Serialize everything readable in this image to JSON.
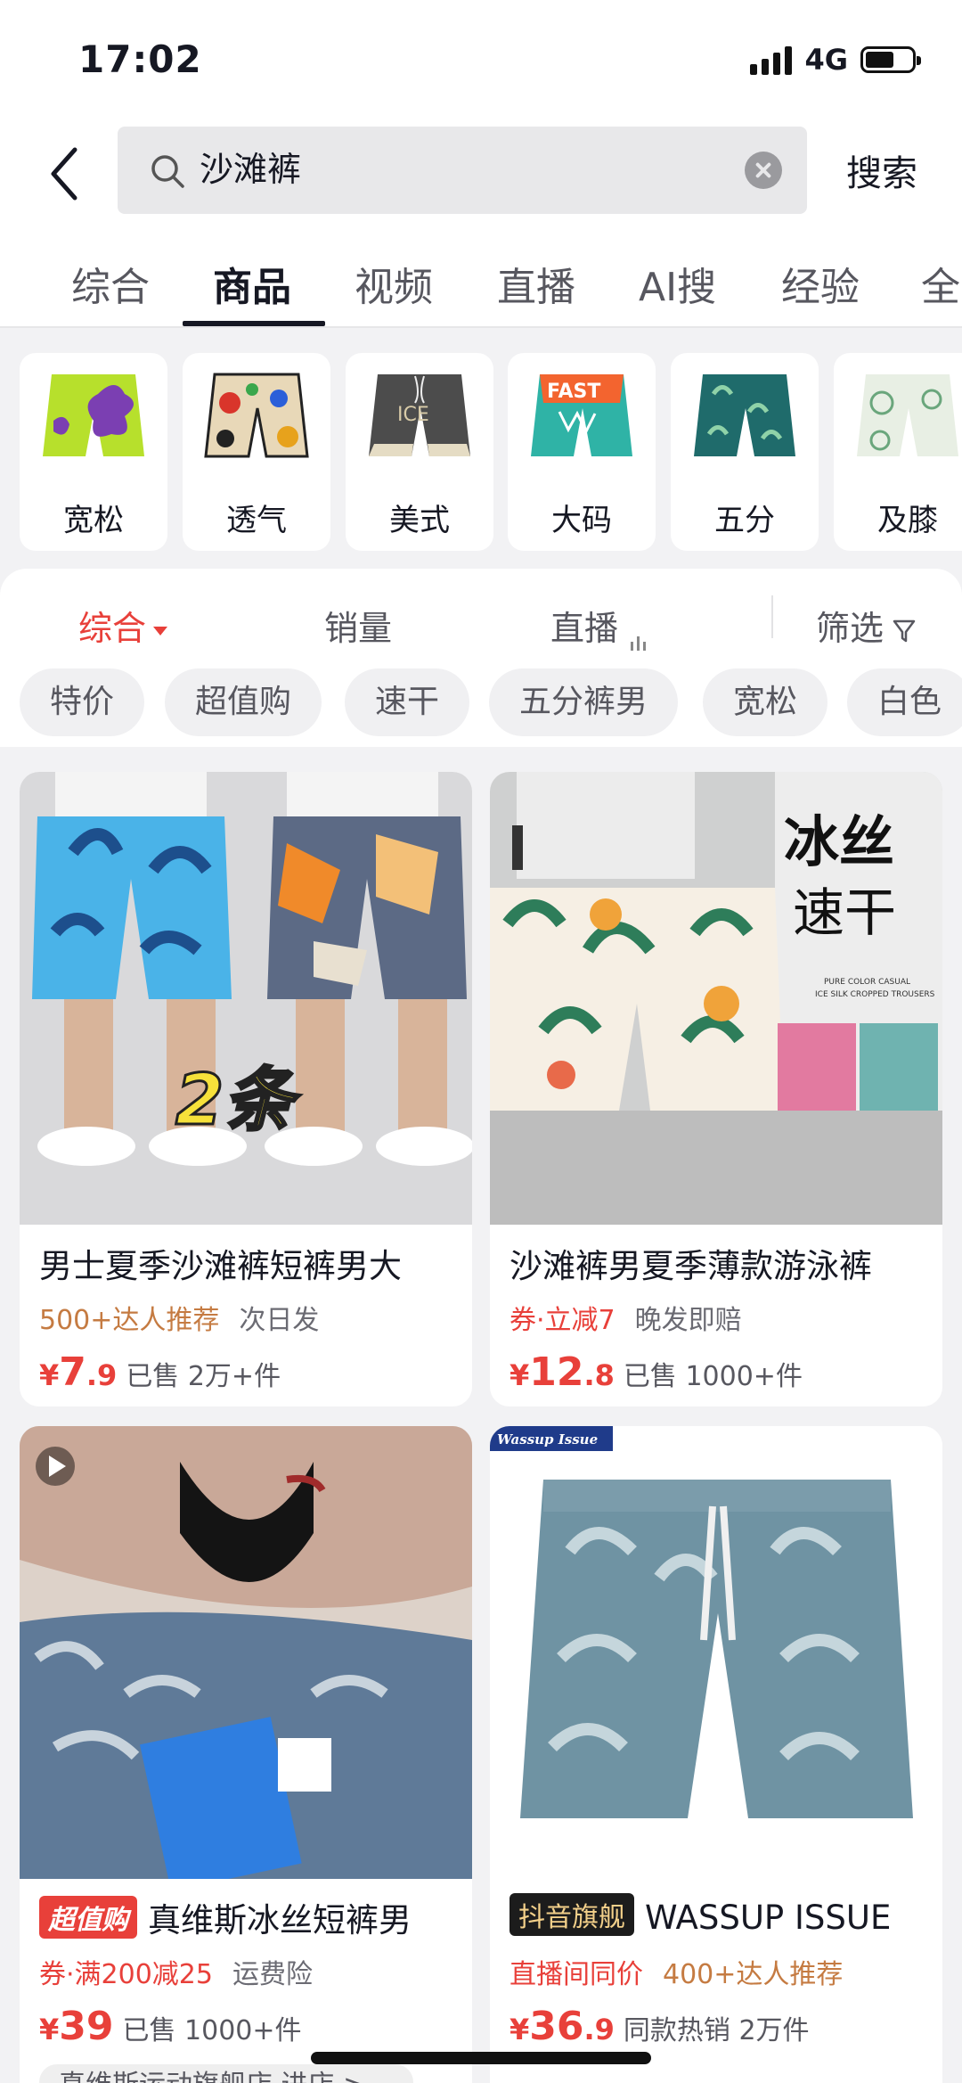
{
  "status_bar": {
    "time": "17:02",
    "network": "4G",
    "battery_level": 0.62
  },
  "search": {
    "query": "沙滩裤",
    "button_label": "搜索"
  },
  "tabs": [
    {
      "label": "综合",
      "active": false
    },
    {
      "label": "商品",
      "active": true
    },
    {
      "label": "视频",
      "active": false
    },
    {
      "label": "直播",
      "active": false
    },
    {
      "label": "AI搜",
      "active": false
    },
    {
      "label": "经验",
      "active": false
    },
    {
      "label": "全",
      "active": false
    }
  ],
  "categories": [
    {
      "label": "宽松"
    },
    {
      "label": "透气"
    },
    {
      "label": "美式"
    },
    {
      "label": "大码"
    },
    {
      "label": "五分"
    },
    {
      "label": "及膝"
    }
  ],
  "sort": {
    "options": [
      {
        "label": "综合",
        "active": true
      },
      {
        "label": "销量",
        "active": false
      },
      {
        "label": "直播",
        "active": false
      }
    ],
    "filter_label": "筛选"
  },
  "quick_filters": [
    "特价",
    "超值购",
    "速干",
    "五分裤男",
    "宽松",
    "白色"
  ],
  "products": [
    {
      "title": "男士夏季沙滩裤短裤男大",
      "image_text": "2条",
      "tags": [
        {
          "text": "500+达人推荐",
          "style": "orange"
        },
        {
          "text": "次日发",
          "style": "gray"
        }
      ],
      "price_int": "7",
      "price_dec": ".9",
      "price_symbol": "¥",
      "sold": "已售 2万+件"
    },
    {
      "title": "沙滩裤男夏季薄款游泳裤",
      "image_text": "冰丝",
      "image_text2": "速干",
      "image_small": "PURE COLOR CASUAL",
      "image_small2": "ICE SILK CROPPED TROUSERS",
      "tags": [
        {
          "text": "券·立减7",
          "style": "red"
        },
        {
          "text": "晚发即赔",
          "style": "gray"
        }
      ],
      "price_int": "12",
      "price_dec": ".8",
      "price_symbol": "¥",
      "sold": "已售 1000+件"
    },
    {
      "badge": "超值购",
      "title": "真维斯冰丝短裤男",
      "tags": [
        {
          "text": "券·满200减25",
          "style": "red"
        },
        {
          "text": "运费险",
          "style": "gray"
        }
      ],
      "price_int": "39",
      "price_dec": "",
      "price_symbol": "¥",
      "sold": "已售 1000+件",
      "store": "真维斯运动旗舰店 进店 >"
    },
    {
      "badge": "抖音旗舰",
      "title": "WASSUP ISSUE",
      "image_brand": "Wassup Issue",
      "tags": [
        {
          "text": "直播间同价",
          "style": "red"
        },
        {
          "text": "400+达人推荐",
          "style": "orange"
        }
      ],
      "price_int": "36",
      "price_dec": ".9",
      "price_symbol": "¥",
      "sold": "同款热销 2万件"
    }
  ],
  "colors": {
    "accent": "#e8403a",
    "tag_orange": "#c57b42",
    "text": "#161823",
    "muted": "#57575f"
  }
}
